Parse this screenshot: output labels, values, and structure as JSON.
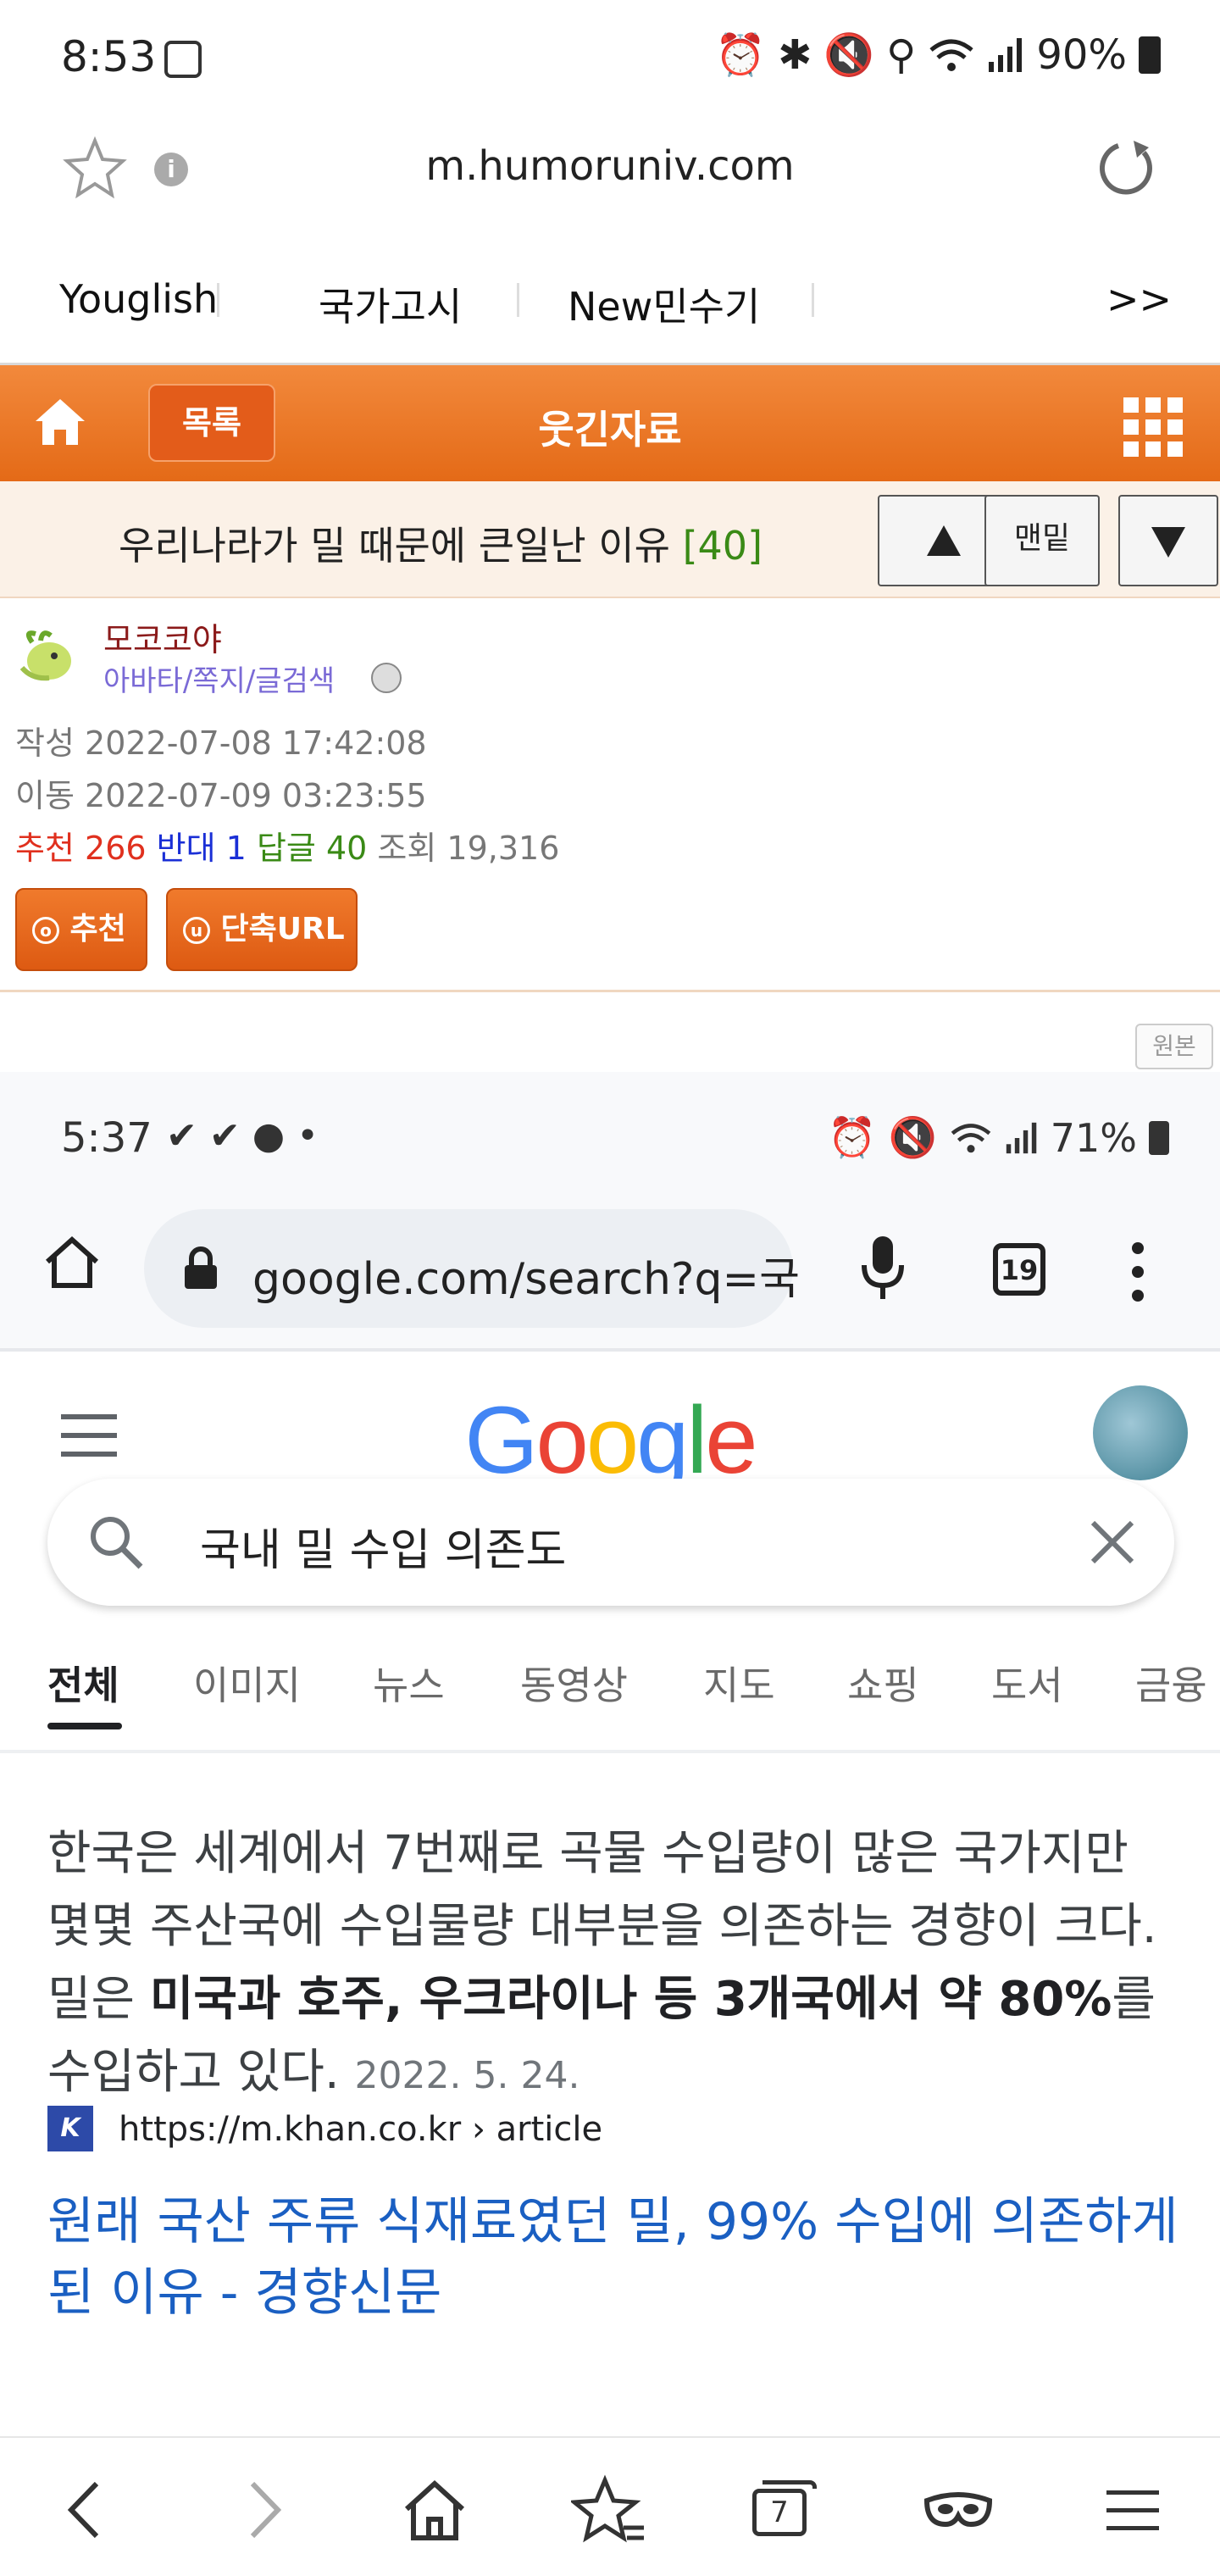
{
  "status": {
    "time": "8:53",
    "battery": "90%"
  },
  "url_bar": {
    "domain": "m.humoruniv.com"
  },
  "bookmarks": [
    "Youglish",
    "국가고시",
    "New민수기"
  ],
  "bookmarks_more": ">>",
  "header": {
    "list_button": "목록",
    "title": "웃긴자료"
  },
  "post": {
    "title": "우리나라가 밀 때문에 큰일난 이유",
    "comment_count": "[40]",
    "bottom_button": "맨밑"
  },
  "author": {
    "name": "모코코야",
    "links": "아바타/쪽지/글검색",
    "written_label": "작성",
    "written": "2022-07-08 17:42:08",
    "moved_label": "이동",
    "moved": "2022-07-09 03:23:55",
    "recommend_label": "추천",
    "recommend": "266",
    "oppose_label": "반대",
    "oppose": "1",
    "replies_label": "답글",
    "replies": "40",
    "views_label": "조회",
    "views": "19,316"
  },
  "actions": {
    "recommend_button": "추천",
    "short_url_button": "단축URL"
  },
  "original_badge": "원본",
  "screenshot": {
    "status_time": "5:37",
    "battery": "71%",
    "address": "google.com/search?q=국",
    "tab_count": "19",
    "logo": "Google",
    "search_query": "국내 밀 수입 의존도",
    "tabs": [
      "전체",
      "이미지",
      "뉴스",
      "동영상",
      "지도",
      "쇼핑",
      "도서",
      "금융"
    ],
    "snippet_plain1": "한국은 세계에서 7번째로 곡물 수입량이 많은 국가지만 몇몇 주산국에 수입물량 대부분을 의존하는 경향이 크다. 밀은 ",
    "snippet_bold": "미국과 호주, 우크라이나 등 3개국에서 약 80%",
    "snippet_plain2": "를 수입하고 있다.",
    "snippet_date": "2022. 5. 24.",
    "result_url": "https://m.khan.co.kr › article",
    "result_title": "원래 국산 주류 식재료였던 밀, 99% 수입에 의존하게 된 이유 - 경향신문"
  },
  "bottom_nav": {
    "tabs_count": "7"
  },
  "colors": {
    "orange": "#e46a17",
    "recommend": "#e0301e",
    "oppose": "#1a2fd6",
    "replies": "#3a8a16",
    "google_link": "#1a5fc2"
  }
}
